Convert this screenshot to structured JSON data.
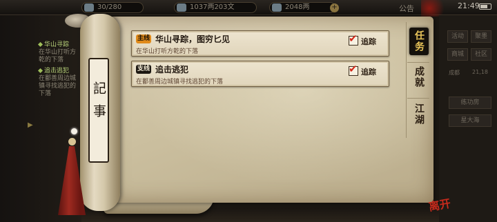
{
  "topbar": {
    "resource1": "30/280",
    "resource2": "1037两203文",
    "resource3": "2048两",
    "announce": "公告",
    "clock": "21:49"
  },
  "left_panel": {
    "quests": [
      {
        "title": "华山寻踪",
        "desc": "在华山打听方乾的下落"
      },
      {
        "title": "追击逃犯",
        "desc": "在鄱善周边城镇寻找逃犯的下落"
      }
    ]
  },
  "right_panel": {
    "buttons": [
      "活动",
      "聚墨",
      "商城",
      "社区"
    ],
    "location": "成都",
    "coords": "21,18",
    "sub_buttons": [
      "练功房",
      "星大海"
    ]
  },
  "journal": {
    "scroll_label": "記事",
    "tabs": [
      {
        "label": "任务",
        "active": true
      },
      {
        "label": "成就",
        "active": false
      },
      {
        "label": "江湖",
        "active": false
      }
    ],
    "quests": [
      {
        "type": "main",
        "badge": "主线",
        "title": "华山寻踪，图穷匕见",
        "desc": "在华山打听方乾的下落",
        "track_label": "追踪",
        "tracked": true
      },
      {
        "type": "side",
        "badge": "支线",
        "title": "追击逃犯",
        "desc": "在鄱善周边城镇寻找逃犯的下落",
        "track_label": "追踪",
        "tracked": true
      }
    ]
  },
  "seal_text": "离开",
  "colors": {
    "main_badge": "#e08a1a",
    "side_badge": "#1d1812",
    "active_tab_text": "#e9c55a",
    "check": "#d22414"
  }
}
